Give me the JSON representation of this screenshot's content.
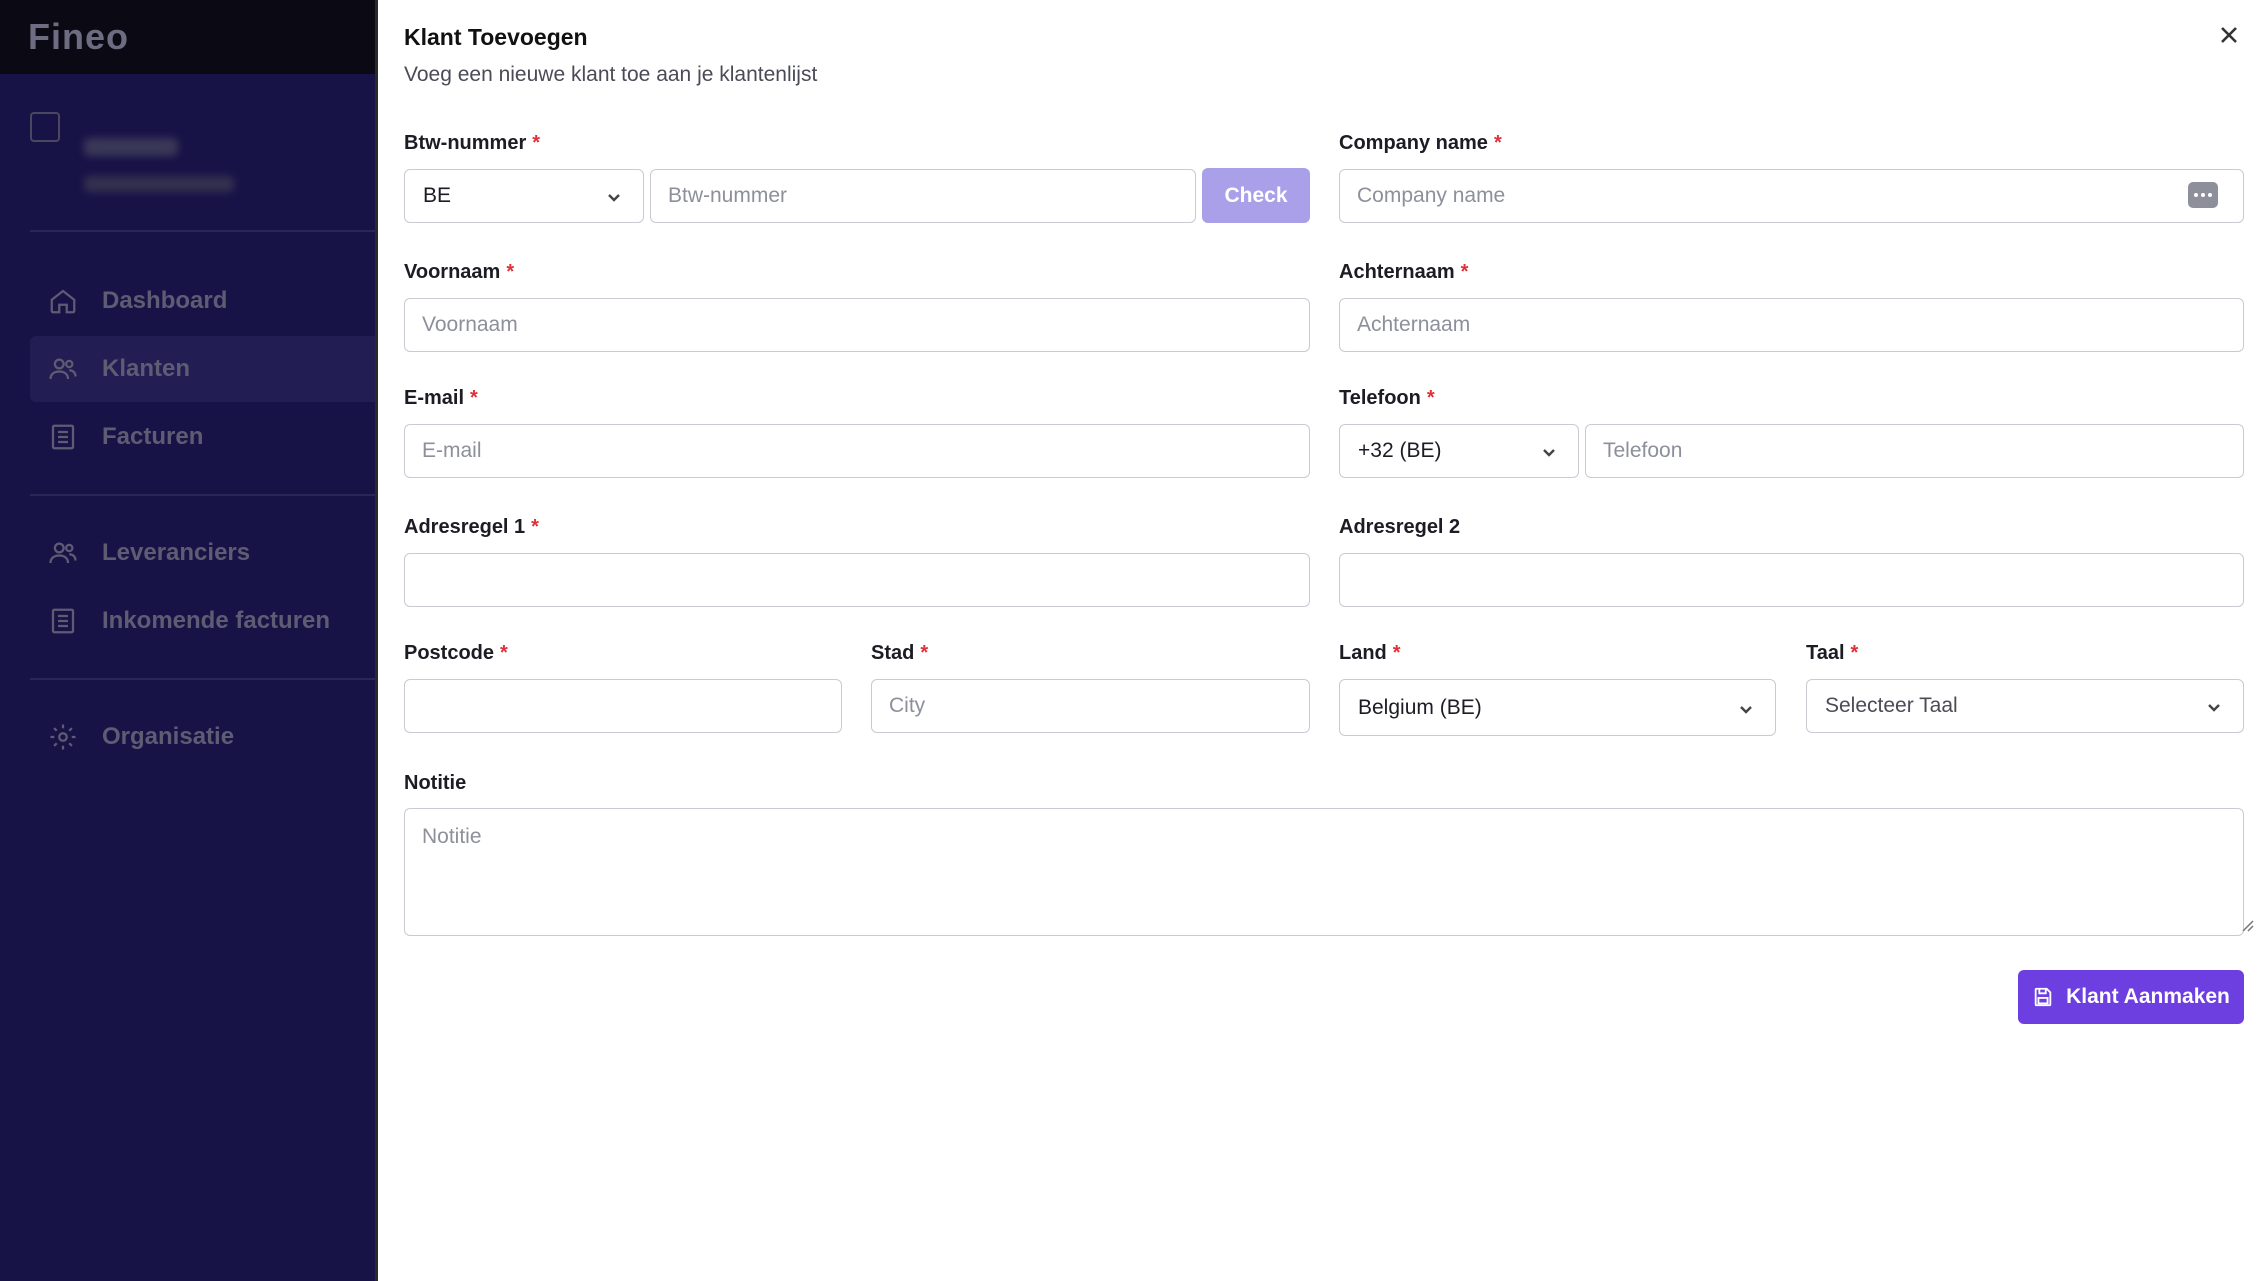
{
  "sidebar": {
    "logo": "Fineo",
    "items": [
      {
        "label": "Dashboard",
        "icon": "home-icon"
      },
      {
        "label": "Klanten",
        "icon": "users-icon"
      },
      {
        "label": "Facturen",
        "icon": "document-icon"
      },
      {
        "label": "Leveranciers",
        "icon": "users-icon"
      },
      {
        "label": "Inkomende facturen",
        "icon": "document-icon"
      },
      {
        "label": "Organisatie",
        "icon": "gear-icon"
      }
    ]
  },
  "modal": {
    "title": "Klant Toevoegen",
    "subtitle": "Voeg een nieuwe klant toe aan je klantenlijst",
    "required_mark": "*",
    "vat": {
      "label": "Btw-nummer",
      "country": "BE",
      "placeholder": "Btw-nummer",
      "check_label": "Check"
    },
    "company": {
      "label": "Company name",
      "placeholder": "Company name"
    },
    "firstname": {
      "label": "Voornaam",
      "placeholder": "Voornaam"
    },
    "lastname": {
      "label": "Achternaam",
      "placeholder": "Achternaam"
    },
    "email": {
      "label": "E-mail",
      "placeholder": "E-mail"
    },
    "phone": {
      "label": "Telefoon",
      "prefix": "+32 (BE)",
      "placeholder": "Telefoon"
    },
    "address1": {
      "label": "Adresregel 1",
      "placeholder": ""
    },
    "address2": {
      "label": "Adresregel 2",
      "placeholder": ""
    },
    "postcode": {
      "label": "Postcode",
      "placeholder": ""
    },
    "city": {
      "label": "Stad",
      "placeholder": "City"
    },
    "country": {
      "label": "Land",
      "value": "Belgium (BE)"
    },
    "language": {
      "label": "Taal",
      "placeholder": "Selecteer Taal"
    },
    "note": {
      "label": "Notitie",
      "placeholder": "Notitie"
    },
    "submit_label": "Klant Aanmaken"
  },
  "colors": {
    "accent": "#6d3ee0",
    "check_button": "#a9a0e9",
    "required": "#e0303a"
  }
}
